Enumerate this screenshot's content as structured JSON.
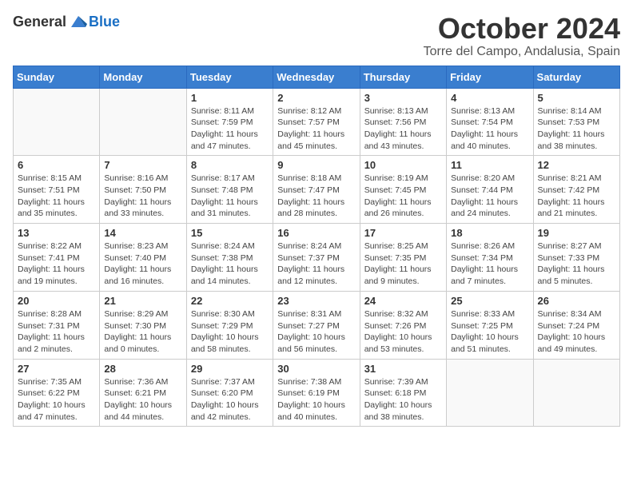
{
  "header": {
    "logo_general": "General",
    "logo_blue": "Blue",
    "month": "October 2024",
    "location": "Torre del Campo, Andalusia, Spain"
  },
  "days_of_week": [
    "Sunday",
    "Monday",
    "Tuesday",
    "Wednesday",
    "Thursday",
    "Friday",
    "Saturday"
  ],
  "weeks": [
    [
      {
        "num": "",
        "info": ""
      },
      {
        "num": "",
        "info": ""
      },
      {
        "num": "1",
        "info": "Sunrise: 8:11 AM\nSunset: 7:59 PM\nDaylight: 11 hours and 47 minutes."
      },
      {
        "num": "2",
        "info": "Sunrise: 8:12 AM\nSunset: 7:57 PM\nDaylight: 11 hours and 45 minutes."
      },
      {
        "num": "3",
        "info": "Sunrise: 8:13 AM\nSunset: 7:56 PM\nDaylight: 11 hours and 43 minutes."
      },
      {
        "num": "4",
        "info": "Sunrise: 8:13 AM\nSunset: 7:54 PM\nDaylight: 11 hours and 40 minutes."
      },
      {
        "num": "5",
        "info": "Sunrise: 8:14 AM\nSunset: 7:53 PM\nDaylight: 11 hours and 38 minutes."
      }
    ],
    [
      {
        "num": "6",
        "info": "Sunrise: 8:15 AM\nSunset: 7:51 PM\nDaylight: 11 hours and 35 minutes."
      },
      {
        "num": "7",
        "info": "Sunrise: 8:16 AM\nSunset: 7:50 PM\nDaylight: 11 hours and 33 minutes."
      },
      {
        "num": "8",
        "info": "Sunrise: 8:17 AM\nSunset: 7:48 PM\nDaylight: 11 hours and 31 minutes."
      },
      {
        "num": "9",
        "info": "Sunrise: 8:18 AM\nSunset: 7:47 PM\nDaylight: 11 hours and 28 minutes."
      },
      {
        "num": "10",
        "info": "Sunrise: 8:19 AM\nSunset: 7:45 PM\nDaylight: 11 hours and 26 minutes."
      },
      {
        "num": "11",
        "info": "Sunrise: 8:20 AM\nSunset: 7:44 PM\nDaylight: 11 hours and 24 minutes."
      },
      {
        "num": "12",
        "info": "Sunrise: 8:21 AM\nSunset: 7:42 PM\nDaylight: 11 hours and 21 minutes."
      }
    ],
    [
      {
        "num": "13",
        "info": "Sunrise: 8:22 AM\nSunset: 7:41 PM\nDaylight: 11 hours and 19 minutes."
      },
      {
        "num": "14",
        "info": "Sunrise: 8:23 AM\nSunset: 7:40 PM\nDaylight: 11 hours and 16 minutes."
      },
      {
        "num": "15",
        "info": "Sunrise: 8:24 AM\nSunset: 7:38 PM\nDaylight: 11 hours and 14 minutes."
      },
      {
        "num": "16",
        "info": "Sunrise: 8:24 AM\nSunset: 7:37 PM\nDaylight: 11 hours and 12 minutes."
      },
      {
        "num": "17",
        "info": "Sunrise: 8:25 AM\nSunset: 7:35 PM\nDaylight: 11 hours and 9 minutes."
      },
      {
        "num": "18",
        "info": "Sunrise: 8:26 AM\nSunset: 7:34 PM\nDaylight: 11 hours and 7 minutes."
      },
      {
        "num": "19",
        "info": "Sunrise: 8:27 AM\nSunset: 7:33 PM\nDaylight: 11 hours and 5 minutes."
      }
    ],
    [
      {
        "num": "20",
        "info": "Sunrise: 8:28 AM\nSunset: 7:31 PM\nDaylight: 11 hours and 2 minutes."
      },
      {
        "num": "21",
        "info": "Sunrise: 8:29 AM\nSunset: 7:30 PM\nDaylight: 11 hours and 0 minutes."
      },
      {
        "num": "22",
        "info": "Sunrise: 8:30 AM\nSunset: 7:29 PM\nDaylight: 10 hours and 58 minutes."
      },
      {
        "num": "23",
        "info": "Sunrise: 8:31 AM\nSunset: 7:27 PM\nDaylight: 10 hours and 56 minutes."
      },
      {
        "num": "24",
        "info": "Sunrise: 8:32 AM\nSunset: 7:26 PM\nDaylight: 10 hours and 53 minutes."
      },
      {
        "num": "25",
        "info": "Sunrise: 8:33 AM\nSunset: 7:25 PM\nDaylight: 10 hours and 51 minutes."
      },
      {
        "num": "26",
        "info": "Sunrise: 8:34 AM\nSunset: 7:24 PM\nDaylight: 10 hours and 49 minutes."
      }
    ],
    [
      {
        "num": "27",
        "info": "Sunrise: 7:35 AM\nSunset: 6:22 PM\nDaylight: 10 hours and 47 minutes."
      },
      {
        "num": "28",
        "info": "Sunrise: 7:36 AM\nSunset: 6:21 PM\nDaylight: 10 hours and 44 minutes."
      },
      {
        "num": "29",
        "info": "Sunrise: 7:37 AM\nSunset: 6:20 PM\nDaylight: 10 hours and 42 minutes."
      },
      {
        "num": "30",
        "info": "Sunrise: 7:38 AM\nSunset: 6:19 PM\nDaylight: 10 hours and 40 minutes."
      },
      {
        "num": "31",
        "info": "Sunrise: 7:39 AM\nSunset: 6:18 PM\nDaylight: 10 hours and 38 minutes."
      },
      {
        "num": "",
        "info": ""
      },
      {
        "num": "",
        "info": ""
      }
    ]
  ]
}
